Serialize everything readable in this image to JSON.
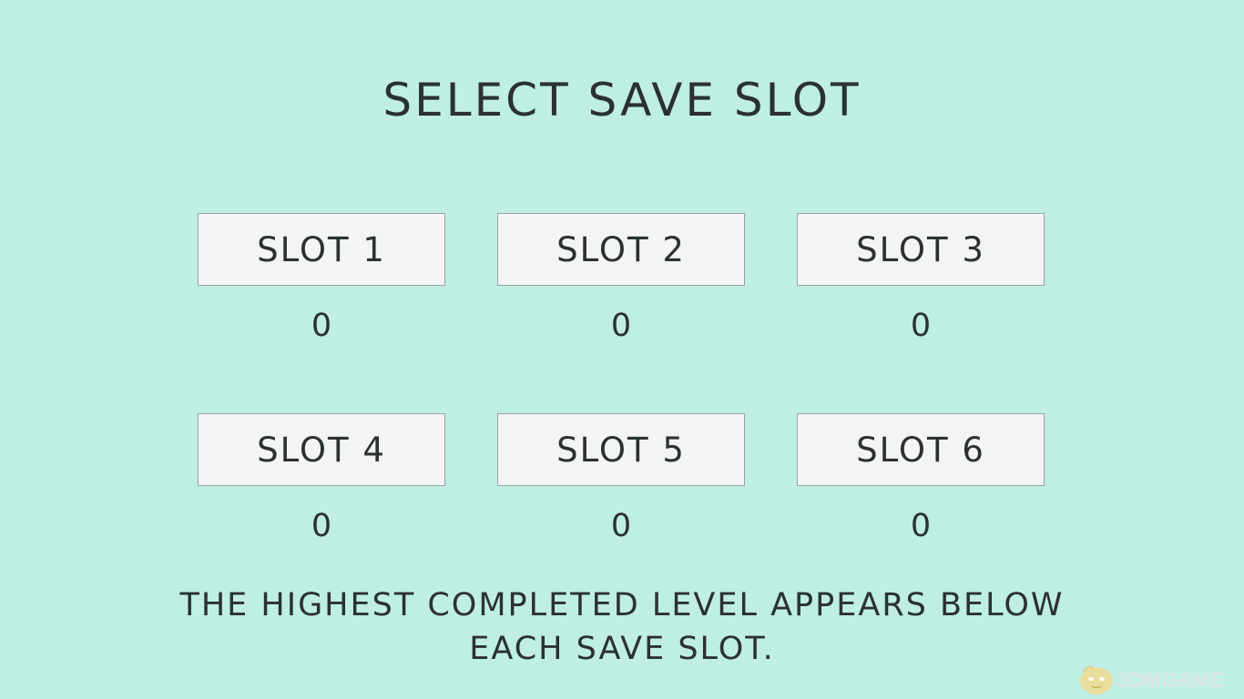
{
  "screen": {
    "title": "SELECT SAVE SLOT",
    "footer_line1": "THE HIGHEST COMPLETED LEVEL APPEARS BELOW",
    "footer_line2": "EACH SAVE SLOT."
  },
  "slots": [
    {
      "label": "SLOT 1",
      "level": "0"
    },
    {
      "label": "SLOT 2",
      "level": "0"
    },
    {
      "label": "SLOT 3",
      "level": "0"
    },
    {
      "label": "SLOT 4",
      "level": "0"
    },
    {
      "label": "SLOT 5",
      "level": "0"
    },
    {
      "label": "SLOT 6",
      "level": "0"
    }
  ],
  "watermark": {
    "text": "3DMGAME",
    "icon": "mascot-logo"
  },
  "colors": {
    "background": "#bfeee4",
    "text": "#2b3133",
    "button_fill": "#f4f4f4",
    "button_border": "#9aa3a2"
  }
}
